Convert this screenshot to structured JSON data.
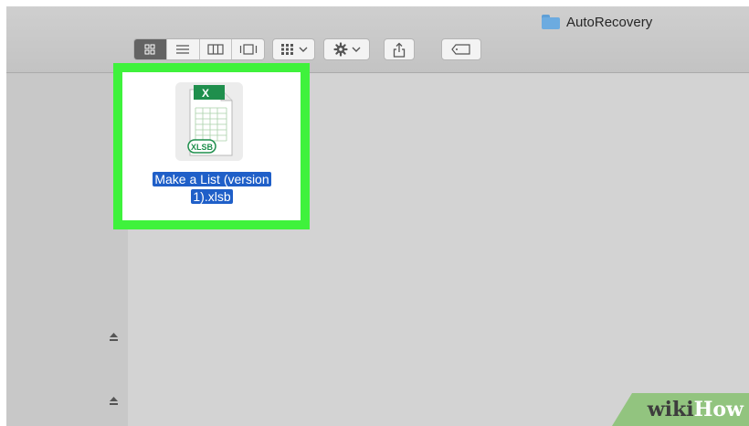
{
  "window": {
    "title": "AutoRecovery"
  },
  "toolbar": {
    "view_modes": [
      {
        "name": "icon-view",
        "active": true
      },
      {
        "name": "list-view",
        "active": false
      },
      {
        "name": "column-view",
        "active": false
      },
      {
        "name": "cover-flow-view",
        "active": false
      }
    ],
    "arrange_icon": "grid-icon",
    "action_icon": "gear-icon",
    "share_icon": "share-icon",
    "tags_icon": "tag-icon",
    "dropdown_icon": "chevron-down-icon"
  },
  "sidebar": {
    "eject_icons": [
      "eject-icon",
      "eject-icon"
    ]
  },
  "file": {
    "icon_badge": "XLSB",
    "app_letter": "X",
    "name_line1": "Make a List (version",
    "name_line2": "1).xlsb"
  },
  "colors": {
    "highlight": "#3ff23c",
    "selection": "#1f5fc8",
    "folder": "#6cabe0",
    "excel_green": "#1f8f4d"
  },
  "watermark": {
    "wiki": "wiki",
    "how": "How"
  }
}
